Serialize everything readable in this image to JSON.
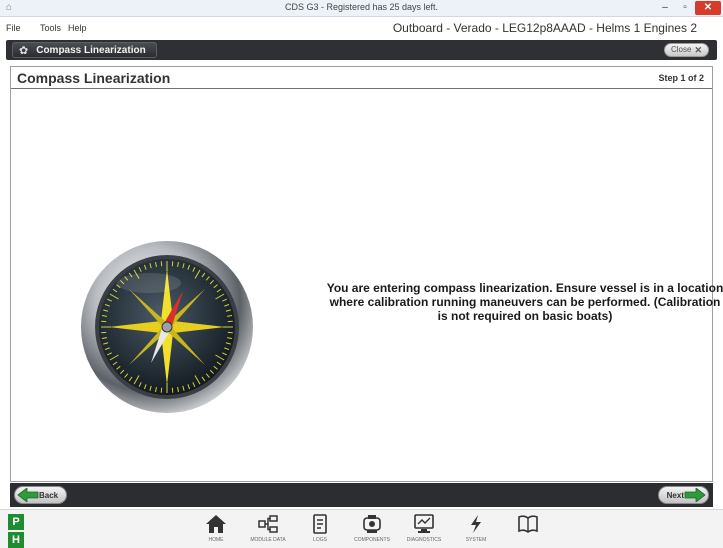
{
  "window": {
    "title": "CDS G3 - Registered has 25 days left.",
    "minimize": "–",
    "maximize": "▫",
    "close": "✕"
  },
  "menu": {
    "items": [
      "File",
      "Tools",
      "Help"
    ],
    "context": "Outboard - Verado - LEG12p8AAAD - Helms 1 Engines 2"
  },
  "header": {
    "tab_label": "Compass Linearization",
    "close_label": "Close"
  },
  "panel": {
    "title": "Compass Linearization",
    "step": "Step 1 of 2",
    "message": "You are entering compass linearization. Ensure vessel is in a location where calibration running maneuvers can be performed. (Calibration is not required on basic boats)"
  },
  "footer": {
    "back_label": "Back",
    "next_label": "Next"
  },
  "taskbar": {
    "badges": [
      "P",
      "H"
    ],
    "tools": [
      {
        "icon": "home-icon",
        "label": "HOME"
      },
      {
        "icon": "module-icon",
        "label": "MODULE DATA"
      },
      {
        "icon": "logs-icon",
        "label": "LOGS"
      },
      {
        "icon": "components-icon",
        "label": "COMPONENTS"
      },
      {
        "icon": "diagnostics-icon",
        "label": "DIAGNOSTICS"
      },
      {
        "icon": "lightning-icon",
        "label": "SYSTEM"
      },
      {
        "icon": "book-icon",
        "label": ""
      }
    ]
  },
  "colors": {
    "accent_green": "#1f8c31",
    "dark_bar": "#2e3034",
    "close_red": "#d63b2b"
  }
}
